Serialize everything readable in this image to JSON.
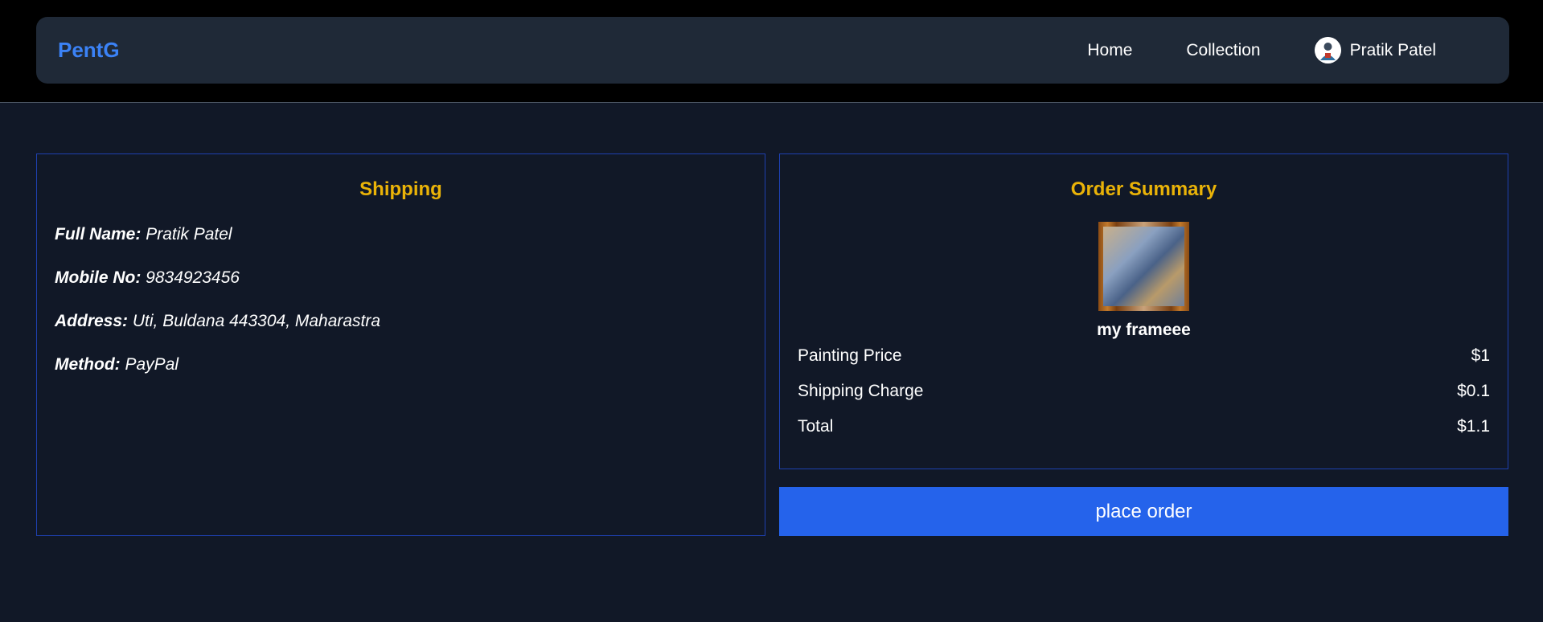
{
  "navbar": {
    "brand": "PentG",
    "links": {
      "home": "Home",
      "collection": "Collection"
    },
    "user": {
      "name": "Pratik Patel",
      "avatar_icon": "user-avatar"
    }
  },
  "shipping": {
    "title": "Shipping",
    "full_name_label": "Full Name:",
    "full_name": "Pratik Patel",
    "mobile_label": "Mobile No:",
    "mobile": "9834923456",
    "address_label": "Address:",
    "address": "Uti, Buldana 443304, Maharastra",
    "method_label": "Method:",
    "method": "PayPal"
  },
  "order_summary": {
    "title": "Order Summary",
    "painting_name": "my frameee",
    "rows": [
      {
        "label": "Painting Price",
        "value": "$1"
      },
      {
        "label": "Shipping Charge",
        "value": "$0.1"
      },
      {
        "label": "Total",
        "value": "$1.1"
      }
    ]
  },
  "actions": {
    "place_order": "place order"
  },
  "colors": {
    "accent": "#3b82f6",
    "title": "#eab308",
    "button": "#2563eb",
    "background": "#111827",
    "navbar": "#1f2937",
    "panel_border": "#1e40af"
  }
}
